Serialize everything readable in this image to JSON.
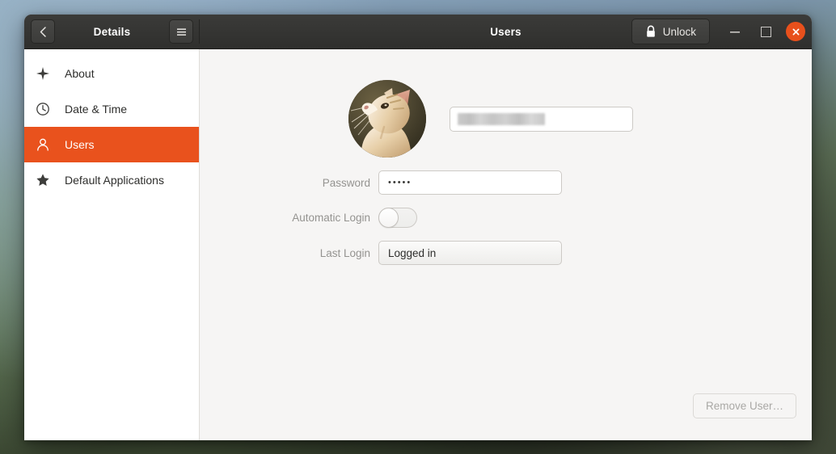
{
  "window": {
    "left_title": "Details",
    "right_title": "Users",
    "back_icon": "chevron-left-icon",
    "menu_icon": "hamburger-menu-icon",
    "unlock_label": "Unlock",
    "unlock_icon": "padlock-locked-icon",
    "minimize_icon": "minimize-icon",
    "maximize_icon": "maximize-icon",
    "close_icon": "close-icon",
    "close_color": "#e8501c"
  },
  "sidebar": {
    "items": [
      {
        "label": "About",
        "icon": "sparkle-star-icon",
        "active": false
      },
      {
        "label": "Date & Time",
        "icon": "clock-icon",
        "active": false
      },
      {
        "label": "Users",
        "icon": "person-icon",
        "active": true
      },
      {
        "label": "Default Applications",
        "icon": "star-icon",
        "active": false
      }
    ],
    "active_color": "#e9521d"
  },
  "user": {
    "avatar_icon": "cat-photo-avatar",
    "name_value": "",
    "name_redacted": true,
    "fields": [
      {
        "label": "Password",
        "value": "•••••",
        "type": "entry"
      },
      {
        "label": "Automatic Login",
        "value": "off",
        "type": "toggle"
      },
      {
        "label": "Last Login",
        "value": "Logged in",
        "type": "button"
      }
    ]
  },
  "actions": {
    "remove_user_label": "Remove User…"
  }
}
